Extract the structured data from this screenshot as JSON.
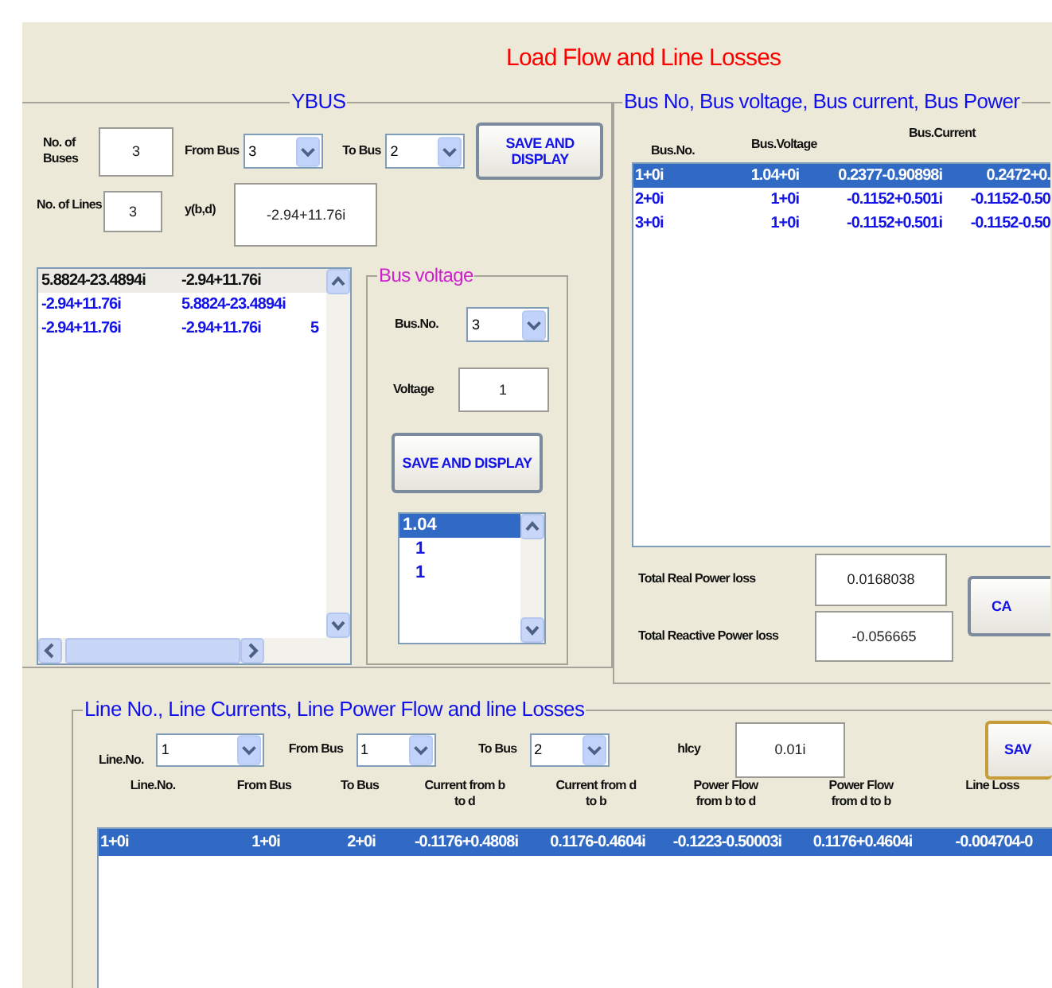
{
  "title": "Load Flow and Line Losses",
  "ybus": {
    "title": "YBUS",
    "buses_label": "No. of Buses",
    "buses_value": "3",
    "from_bus_label": "From Bus",
    "from_bus_value": "3",
    "to_bus_label": "To Bus",
    "to_bus_value": "2",
    "save_button": "SAVE AND DISPLAY",
    "lines_label": "No. of Lines",
    "lines_value": "3",
    "y_label": "y(b,d)",
    "y_value": "-2.94+11.76i",
    "matrix_rows": [
      {
        "cells": [
          "5.8824-23.4894i",
          "-2.94+11.76i"
        ],
        "selected": true
      },
      {
        "cells": [
          "-2.94+11.76i",
          "5.8824-23.4894i"
        ],
        "selected": false
      },
      {
        "cells": [
          "-2.94+11.76i",
          "-2.94+11.76i",
          "5"
        ],
        "selected": false
      }
    ],
    "bus_voltage": {
      "title": "Bus voltage",
      "bus_label": "Bus.No.",
      "bus_value": "3",
      "voltage_label": "Voltage",
      "voltage_value": "1",
      "save_button": "SAVE AND DISPLAY",
      "values": [
        {
          "text": "1.04",
          "selected": true
        },
        {
          "text": "1",
          "selected": false
        },
        {
          "text": "1",
          "selected": false
        }
      ]
    }
  },
  "bus_panel": {
    "title": "Bus No, Bus voltage, Bus current, Bus Power",
    "columns": [
      "Bus.No.",
      "Bus.Voltage",
      "Bus.Current"
    ],
    "rows": [
      {
        "cells": [
          "1+0i",
          "1.04+0i",
          "0.2377-0.90898i",
          "0.2472+0."
        ],
        "selected": true
      },
      {
        "cells": [
          "2+0i",
          "1+0i",
          "-0.1152+0.501i",
          "-0.1152-0.50"
        ],
        "selected": false
      },
      {
        "cells": [
          "3+0i",
          "1+0i",
          "-0.1152+0.501i",
          "-0.1152-0.50"
        ],
        "selected": false
      }
    ],
    "real_loss_label": "Total Real Power loss",
    "real_loss_value": "0.0168038",
    "reactive_loss_label": "Total Reactive Power loss",
    "reactive_loss_value": "-0.056665",
    "button": "CA"
  },
  "lines_panel": {
    "title": "Line No., Line Currents, Line Power Flow and line Losses",
    "line_label": "Line.No.",
    "line_value": "1",
    "from_label": "From Bus",
    "from_value": "1",
    "to_label": "To Bus",
    "to_value": "2",
    "hlcy_label": "hlcy",
    "hlcy_value": "0.01i",
    "button": "SAV",
    "columns": [
      "Line.No.",
      "From Bus",
      "To Bus",
      "Current from b to d",
      "Current from d to b",
      "Power Flow from b to d",
      "Power Flow from d to b",
      "Line Loss"
    ],
    "rows": [
      {
        "cells": [
          "1+0i",
          "1+0i",
          "2+0i",
          "-0.1176+0.4808i",
          "0.1176-0.4604i",
          "-0.1223-0.50003i",
          "0.1176+0.4604i",
          "-0.004704-0"
        ],
        "selected": true
      }
    ]
  }
}
